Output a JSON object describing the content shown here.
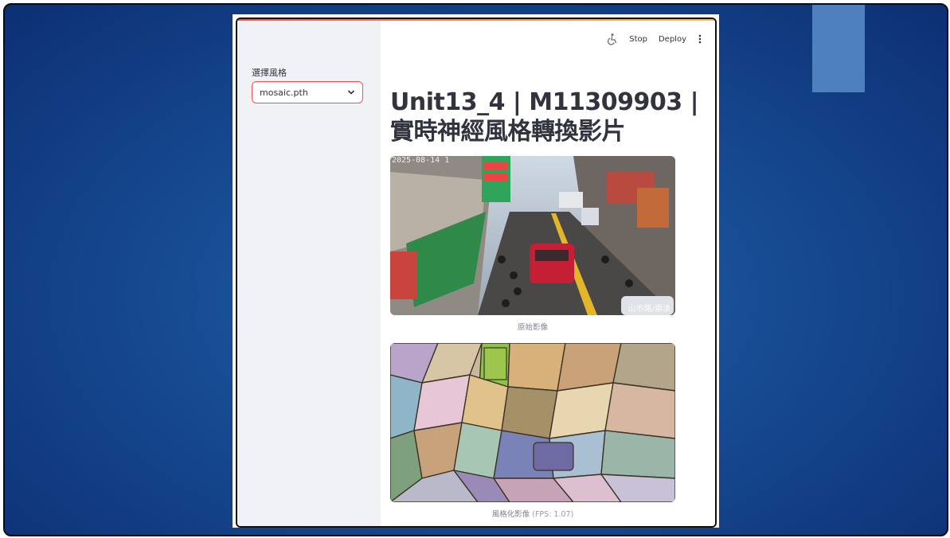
{
  "sidebar": {
    "label": "選擇風格",
    "select_value": "mosaic.pth"
  },
  "toolbar": {
    "stop_label": "Stop",
    "deploy_label": "Deploy"
  },
  "main": {
    "title": "Unit13_4 | M11309903 | 實時神經風格轉換影片",
    "original_caption": "原始影像",
    "original_timestamp": "2025-08-14 1",
    "original_watermark": "山市路/崇法",
    "stylized_caption_prefix": "風格化影像",
    "stylized_caption_fps": "(FPS: 1.07)"
  },
  "colors": {
    "accent": "#ff4b4b",
    "sidebar_bg": "#f0f2f6",
    "text": "#31333f",
    "caption": "#808495",
    "slide_bg": "#184f96",
    "slide_deco": "#4e7fbe"
  }
}
